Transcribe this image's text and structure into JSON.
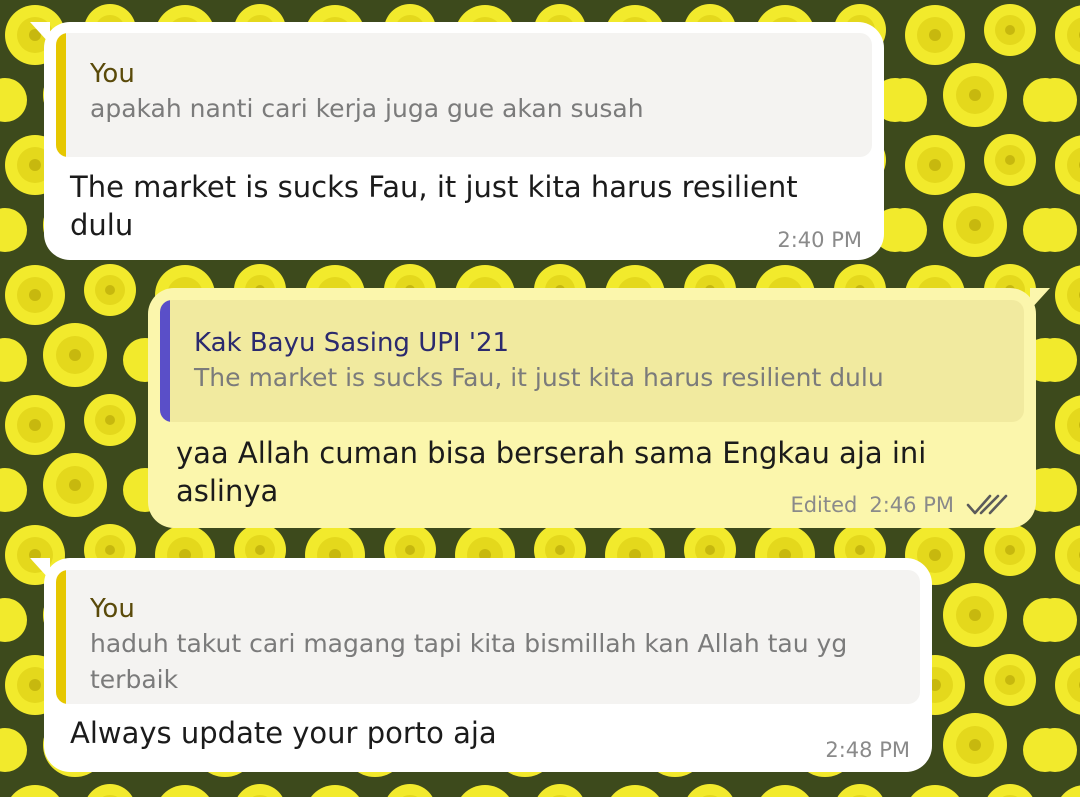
{
  "colors": {
    "incoming_bubble": "#ffffff",
    "outgoing_bubble": "#fbf6ac",
    "you_quote_bar": "#e6c700",
    "you_name": "#5a4a0a",
    "contact_quote_bar": "#5a4fc8",
    "contact_name": "#2b2a6e",
    "meta_text": "#8a8a8a"
  },
  "wallpaper": {
    "description_icon": "yellow-flowers-wallpaper"
  },
  "messages": [
    {
      "direction": "in",
      "quote": {
        "author": "You",
        "text": "apakah nanti cari kerja juga gue akan susah"
      },
      "text": "The market is sucks Fau, it just kita harus resilient dulu",
      "time": "2:40 PM"
    },
    {
      "direction": "out",
      "quote": {
        "author": "Kak Bayu Sasing UPI '21",
        "text": "The market is sucks Fau, it just kita harus resilient dulu"
      },
      "text": "yaa Allah cuman bisa berserah sama Engkau aja ini aslinya",
      "edited": "Edited",
      "time": "2:46 PM",
      "status_icon": "double-check-icon"
    },
    {
      "direction": "in",
      "quote": {
        "author": "You",
        "text": "haduh takut cari magang tapi kita bismillah kan Allah tau yg terbaik"
      },
      "text": "Always update your porto aja",
      "time": "2:48 PM"
    }
  ]
}
